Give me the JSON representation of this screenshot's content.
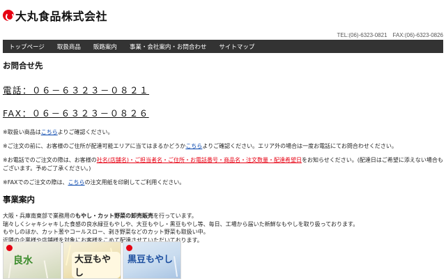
{
  "header": {
    "company_name": "大丸食品株式会社",
    "contact_line": "TEL:(06)-6323-0821　FAX:(06)-6323-0826"
  },
  "nav": {
    "items": [
      {
        "label": "トップページ"
      },
      {
        "label": "取扱商品"
      },
      {
        "label": "販路案内"
      },
      {
        "label": "事業・会社案内・お問合わせ"
      },
      {
        "label": "サイトマップ"
      }
    ]
  },
  "inquiry": {
    "title": "お問合せ先",
    "phone": "電話：０６－６３２３－０８２１",
    "fax": "FAX：０６－６３２３－０８２６",
    "note1": {
      "before": "※取扱い商品は",
      "link": "こちら",
      "after": "よりご確認ください。"
    },
    "note2": {
      "before": "※ご注文の前に、お客様のご住所が配達可能エリアに当てはまるかどうか",
      "link": "こちら",
      "after": "よりご確認ください。エリア外の場合は一度お電話にてお問合わせください。"
    },
    "note3": {
      "before": "※お電話でのご注文の際は、お客様の",
      "highlight": "社名(店舗名)・ご担当者名・ご住所・お電話番号・商品名・注文数量・配達希望日",
      "after": "をお知らせください。(配達日はご希望に添えない場合もございます。予めご了承ください。)"
    },
    "note4": {
      "before": "※FAXでのご注文の際は、",
      "link": "こちら",
      "after": "の注文用紙を印刷してご利用ください。"
    }
  },
  "business": {
    "title": "事業案内",
    "line1_before": "大阪・兵庫南東部で業務用の",
    "line1_bold": "もやし・カット野菜の卸売販売",
    "line1_after": "を行っています。",
    "line2": "瑞々しくシャキシャキした食感の良水緑豆もやしや、大豆もやし・黒豆もやし等、毎日、工場から届いた新鮮なもやしを取り扱っております。",
    "line3": "もやしのほか、カット葱やコールスロー、剥き野菜などのカット野菜も取扱い中。",
    "line4": "近隣の企業様や店舗様を対象にお客様をこめて配達させていただいております。"
  },
  "photos": [
    {
      "label": "良水",
      "icon": "bean-sprout-package-photo"
    },
    {
      "label": "大豆もやし",
      "icon": "soybean-sprout-package-photo"
    },
    {
      "label": "黒豆もやし",
      "icon": "black-bean-sprout-package-photo"
    }
  ],
  "colors": {
    "nav_bg": "#333333",
    "link": "#0645ad",
    "highlight_red": "#e60012",
    "logo_red": "#e60012"
  }
}
